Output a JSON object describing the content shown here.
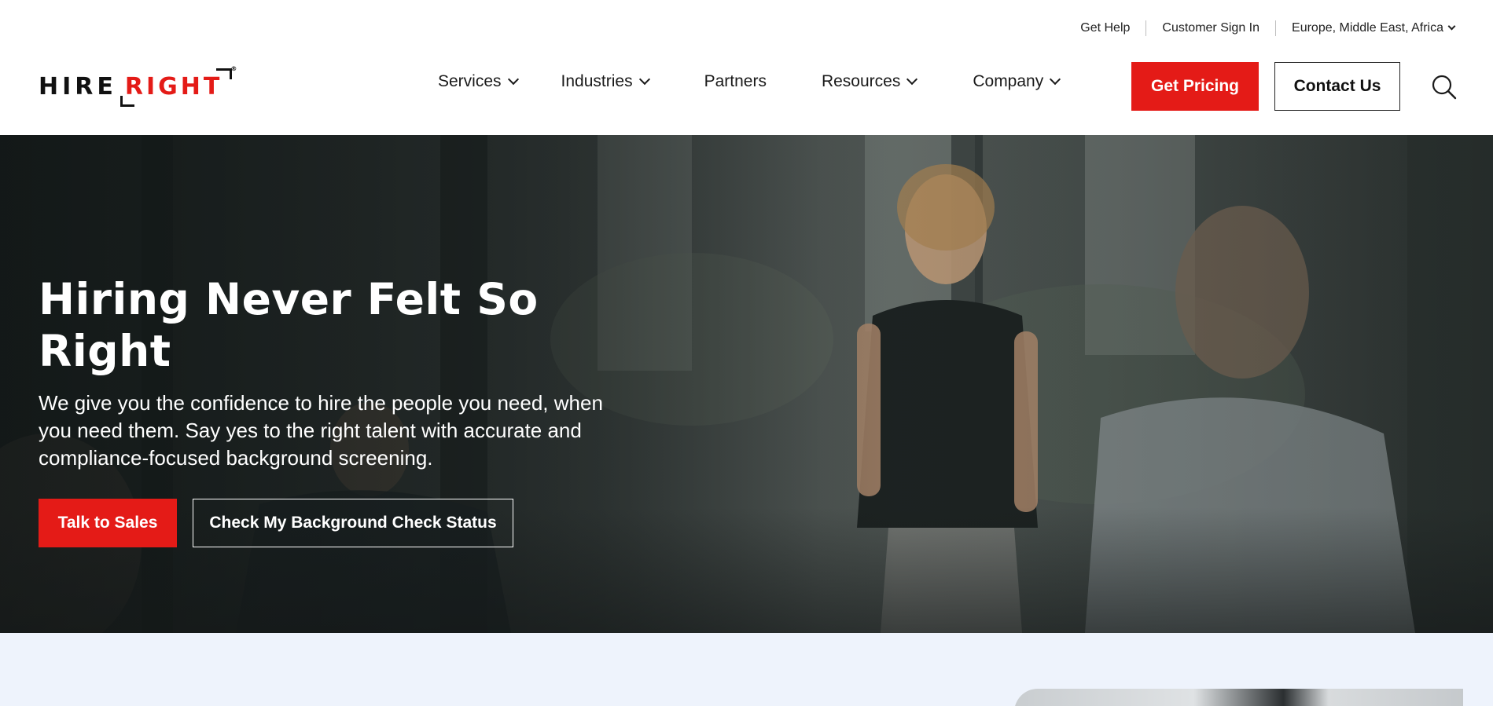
{
  "utility": {
    "get_help": "Get Help",
    "sign_in": "Customer Sign In",
    "region": "Europe, Middle East, Africa"
  },
  "logo": {
    "hire": "HIRE",
    "right": "RIGHT",
    "reg": "®"
  },
  "nav": {
    "services": "Services",
    "industries": "Industries",
    "partners": "Partners",
    "resources": "Resources",
    "company": "Company"
  },
  "header_buttons": {
    "pricing": "Get Pricing",
    "contact": "Contact Us"
  },
  "hero": {
    "title": "Hiring Never Felt So Right",
    "subtitle": "We give you the confidence to hire the people you need, when you need them. Say yes to the right talent with accurate and compliance-focused background screening.",
    "primary_cta": "Talk to Sales",
    "secondary_cta": "Check My Background Check Status"
  },
  "colors": {
    "brand_red": "#e41b17",
    "text_dark": "#1a1a1a",
    "section_bg": "#eef3fc"
  },
  "icons": {
    "search": "search-icon",
    "chevron": "chevron-down-icon"
  }
}
